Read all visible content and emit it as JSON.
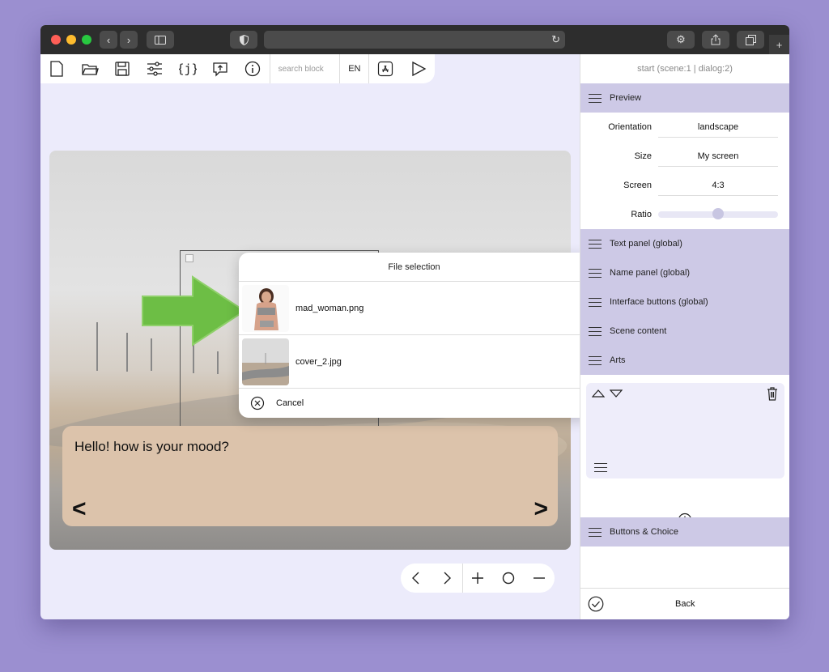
{
  "toolbar": {
    "search_placeholder": "search block",
    "language": "EN"
  },
  "stage": {
    "dialog_text": "Hello! how is your mood?",
    "prev_arrow": "<",
    "next_arrow": ">"
  },
  "file_dialog": {
    "title": "File selection",
    "files": [
      {
        "name": "mad_woman.png"
      },
      {
        "name": "cover_2.jpg"
      }
    ],
    "cancel_label": "Cancel"
  },
  "right_panel": {
    "header": "start (scene:1 | dialog:2)",
    "preview_label": "Preview",
    "properties": [
      {
        "label": "Orientation",
        "value": "landscape"
      },
      {
        "label": "Size",
        "value": "My screen"
      },
      {
        "label": "Screen",
        "value": "4:3"
      }
    ],
    "ratio_label": "Ratio",
    "ratio_value": 0.5,
    "sections": [
      "Text panel (global)",
      "Name panel (global)",
      "Interface buttons (global)",
      "Scene content",
      "Arts"
    ],
    "buttons_choice_label": "Buttons & Choice",
    "back_label": "Back"
  },
  "colors": {
    "background": "#9b8fd0",
    "window_bg": "#ecebfb",
    "section_bg": "#cdc9e6",
    "text_panel": "#dcc3ab",
    "arrow_green": "#6dbe45"
  }
}
